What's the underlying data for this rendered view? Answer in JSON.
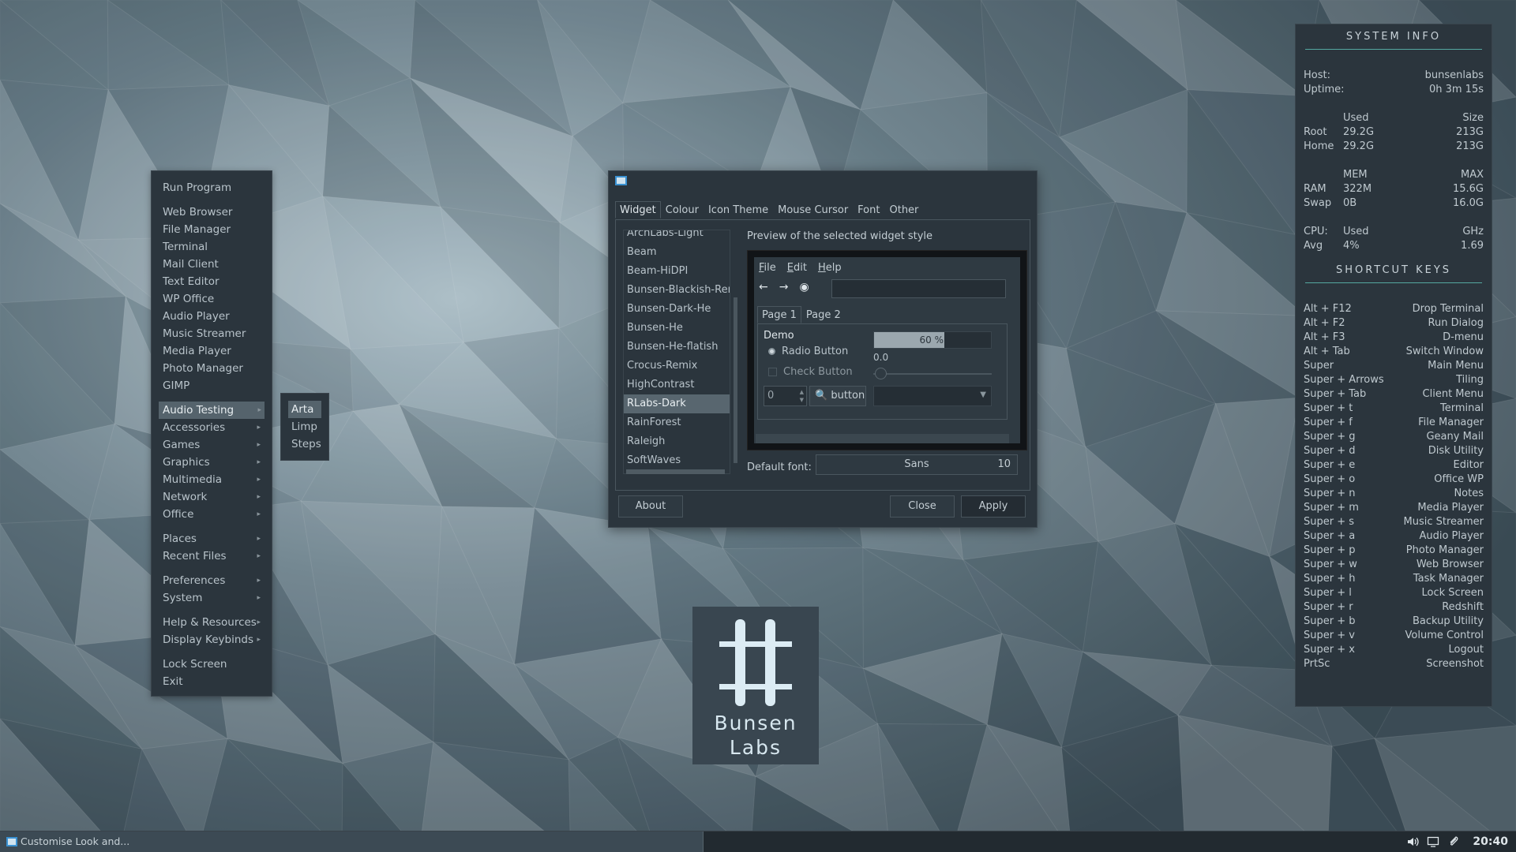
{
  "root_menu": {
    "items": [
      {
        "label": "Run Program"
      },
      {
        "sep": true
      },
      {
        "label": "Web Browser"
      },
      {
        "label": "File Manager"
      },
      {
        "label": "Terminal"
      },
      {
        "label": "Mail Client"
      },
      {
        "label": "Text Editor"
      },
      {
        "label": "WP Office"
      },
      {
        "label": "Audio Player"
      },
      {
        "label": "Music Streamer"
      },
      {
        "label": "Media Player"
      },
      {
        "label": "Photo Manager"
      },
      {
        "label": "GIMP"
      },
      {
        "sep": true
      },
      {
        "label": "Audio Testing",
        "submenu": true,
        "selected": true
      },
      {
        "label": "Accessories",
        "submenu": true
      },
      {
        "label": "Games",
        "submenu": true
      },
      {
        "label": "Graphics",
        "submenu": true
      },
      {
        "label": "Multimedia",
        "submenu": true
      },
      {
        "label": "Network",
        "submenu": true
      },
      {
        "label": "Office",
        "submenu": true
      },
      {
        "sep": true
      },
      {
        "label": "Places",
        "submenu": true
      },
      {
        "label": "Recent Files",
        "submenu": true
      },
      {
        "sep": true
      },
      {
        "label": "Preferences",
        "submenu": true
      },
      {
        "label": "System",
        "submenu": true
      },
      {
        "sep": true
      },
      {
        "label": "Help & Resources",
        "submenu": true
      },
      {
        "label": "Display Keybinds",
        "submenu": true
      },
      {
        "sep": true
      },
      {
        "label": "Lock Screen"
      },
      {
        "label": "Exit"
      }
    ]
  },
  "audio_submenu": {
    "items": [
      {
        "label": "Arta",
        "selected": true
      },
      {
        "label": "Limp"
      },
      {
        "label": "Steps"
      }
    ]
  },
  "dialog": {
    "tabs": [
      "Widget",
      "Colour",
      "Icon Theme",
      "Mouse Cursor",
      "Font",
      "Other"
    ],
    "active_tab": "Widget",
    "themes": [
      "ArchLabs-Light",
      "Beam",
      "Beam-HiDPI",
      "Bunsen-Blackish-Remi",
      "Bunsen-Dark-He",
      "Bunsen-He",
      "Bunsen-He-flatish",
      "Crocus-Remix",
      "HighContrast",
      "RLabs-Dark",
      "RainForest",
      "Raleigh",
      "SoftWaves"
    ],
    "selected_theme": "RLabs-Dark",
    "preview_label": "Preview of the selected widget style",
    "preview": {
      "menus": [
        "File",
        "Edit",
        "Help"
      ],
      "tabs": [
        "Page 1",
        "Page 2"
      ],
      "demo_label": "Demo",
      "radio_label": "Radio Button",
      "check_label": "Check Button",
      "progress_fraction": 0.6,
      "progress_text": "60 %",
      "scale_value": "0.0",
      "spin_value": "0",
      "button_label": "button"
    },
    "default_font_label": "Default font:",
    "font_name": "Sans",
    "font_size": "10",
    "buttons": {
      "about": "About",
      "close": "Close",
      "apply": "Apply"
    }
  },
  "logo": {
    "line1": "Bunsen",
    "line2": "Labs"
  },
  "conky": {
    "system_title": "SYSTEM INFO",
    "host": {
      "label": "Host:",
      "value": "bunsenlabs"
    },
    "uptime": {
      "label": "Uptime:",
      "value": "0h 3m 15s"
    },
    "disk_head": {
      "c2": "Used",
      "c3": "Size"
    },
    "disks": [
      {
        "name": "Root",
        "used": "29.2G",
        "size": "213G"
      },
      {
        "name": "Home",
        "used": "29.2G",
        "size": "213G"
      }
    ],
    "mem_head": {
      "c2": "MEM",
      "c3": "MAX"
    },
    "mem": [
      {
        "name": "RAM",
        "used": "322M",
        "max": "15.6G"
      },
      {
        "name": "Swap",
        "used": "0B",
        "max": "16.0G"
      }
    ],
    "cpu_head": {
      "c1": "CPU:",
      "c2": "Used",
      "c3": "GHz"
    },
    "cpu": {
      "name": "Avg",
      "used": "4%",
      "ghz": "1.69"
    },
    "shortcut_title": "SHORTCUT KEYS",
    "shortcuts": [
      {
        "key": "Alt + F12",
        "action": "Drop Terminal"
      },
      {
        "key": "Alt + F2",
        "action": "Run Dialog"
      },
      {
        "key": "Alt + F3",
        "action": "D-menu"
      },
      {
        "key": "Alt + Tab",
        "action": "Switch Window"
      },
      {
        "key": "Super",
        "action": "Main Menu"
      },
      {
        "key": "Super + Arrows",
        "action": "Tiling"
      },
      {
        "key": "Super + Tab",
        "action": "Client Menu"
      },
      {
        "key": "Super + t",
        "action": "Terminal"
      },
      {
        "key": "Super + f",
        "action": "File Manager"
      },
      {
        "key": "Super + g",
        "action": "Geany Mail"
      },
      {
        "key": "Super + d",
        "action": "Disk Utility"
      },
      {
        "key": "Super + e",
        "action": "Editor"
      },
      {
        "key": "Super + o",
        "action": "Office WP"
      },
      {
        "key": "Super + n",
        "action": "Notes"
      },
      {
        "key": "Super + m",
        "action": "Media Player"
      },
      {
        "key": "Super + s",
        "action": "Music Streamer"
      },
      {
        "key": "Super + a",
        "action": "Audio Player"
      },
      {
        "key": "Super + p",
        "action": "Photo Manager"
      },
      {
        "key": "Super + w",
        "action": "Web Browser"
      },
      {
        "key": "Super + h",
        "action": "Task Manager"
      },
      {
        "key": "Super + l",
        "action": "Lock Screen"
      },
      {
        "key": "Super + r",
        "action": "Redshift"
      },
      {
        "key": "Super + b",
        "action": "Backup Utility"
      },
      {
        "key": "Super + v",
        "action": "Volume Control"
      },
      {
        "key": "Super + x",
        "action": "Logout"
      },
      {
        "key": "PrtSc",
        "action": "Screenshot"
      }
    ]
  },
  "taskbar": {
    "task_label": "Customise Look and...",
    "clock": "20:40",
    "tray_icons": [
      "volume-icon",
      "display-icon",
      "clip-icon"
    ]
  }
}
